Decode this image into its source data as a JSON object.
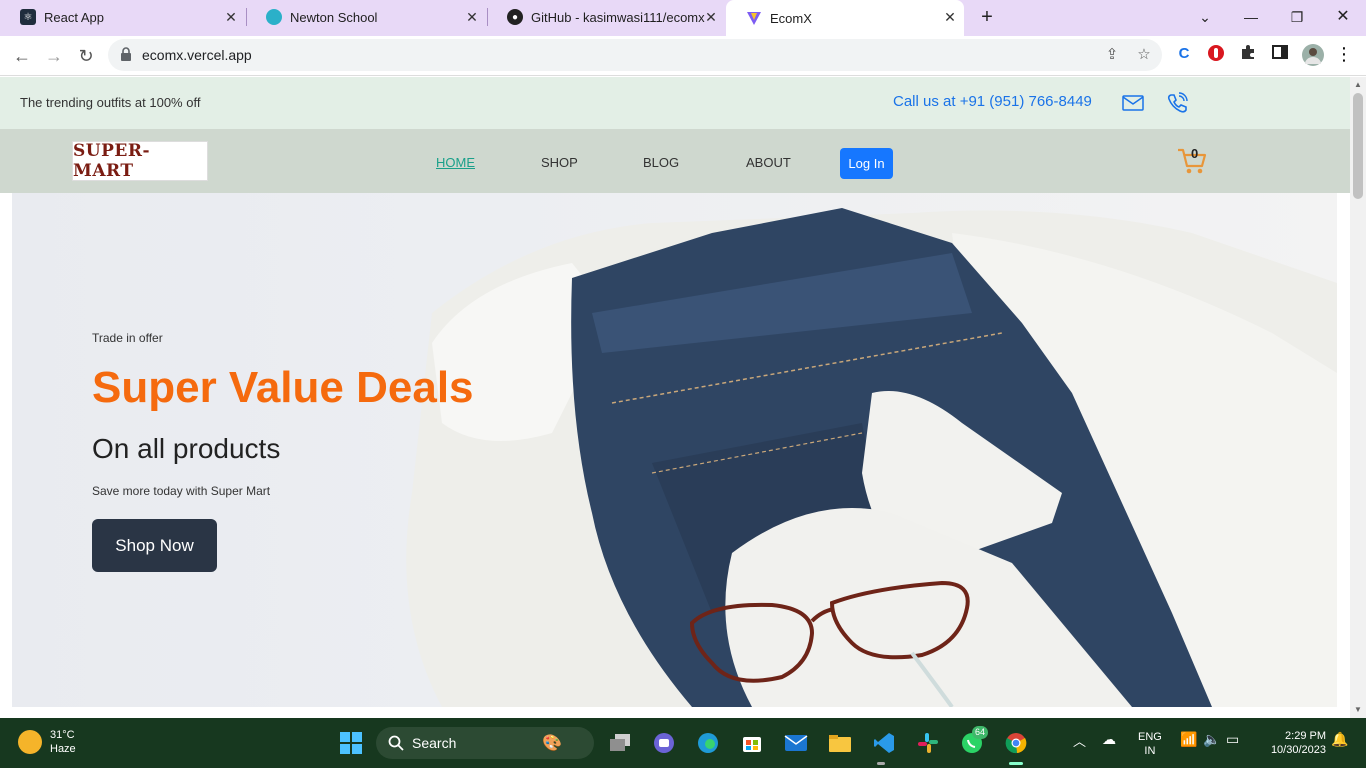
{
  "browser": {
    "tabs": [
      {
        "label": "React App",
        "favicon": "react-icon",
        "color": "#1f2d3d"
      },
      {
        "label": "Newton School",
        "favicon": "newton-icon",
        "color": "#2bb0c9"
      },
      {
        "label": "GitHub - kasimwasi111/ecomx",
        "favicon": "github-icon",
        "color": "#222"
      },
      {
        "label": "EcomX",
        "favicon": "vite-icon",
        "color": "#7d5cf2"
      }
    ],
    "url": "ecomx.vercel.app"
  },
  "site": {
    "topbar": {
      "tagline": "The trending outfits at 100% off",
      "call": "Call us at +91 (951) 766-8449"
    },
    "logo_text": "SUPER-MART",
    "nav": {
      "home": "HOME",
      "shop": "SHOP",
      "blog": "BLOG",
      "about": "ABOUT",
      "login": "Log In",
      "cart_count": "0"
    },
    "hero": {
      "eyebrow": "Trade in offer",
      "headline": "Super Value Deals",
      "subheadline": "On all products",
      "description": "Save more today with Super Mart",
      "cta": "Shop Now"
    },
    "colors": {
      "accent": "#f56a0e",
      "link_active": "#1aa08a",
      "button": "#1677ff",
      "cta_bg": "#2a3545"
    }
  },
  "taskbar": {
    "weather_temp": "31°C",
    "weather_desc": "Haze",
    "search_label": "Search",
    "whatsapp_badge": "64",
    "lang_1": "ENG",
    "lang_2": "IN",
    "time": "2:29 PM",
    "date": "10/30/2023"
  }
}
